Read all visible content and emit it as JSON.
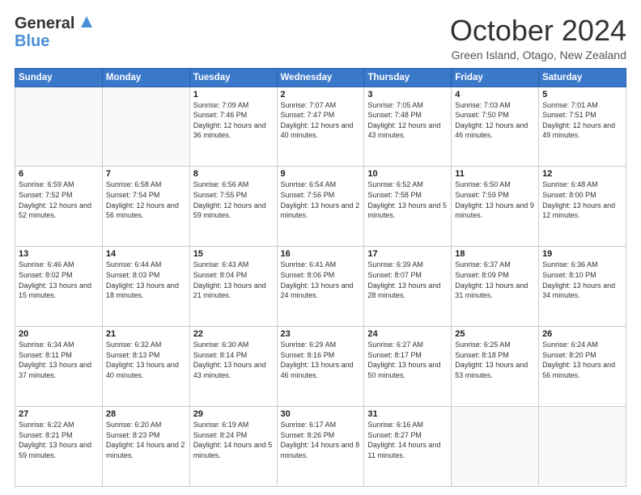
{
  "header": {
    "logo_general": "General",
    "logo_blue": "Blue",
    "month_title": "October 2024",
    "subtitle": "Green Island, Otago, New Zealand"
  },
  "weekdays": [
    "Sunday",
    "Monday",
    "Tuesday",
    "Wednesday",
    "Thursday",
    "Friday",
    "Saturday"
  ],
  "weeks": [
    [
      {
        "day": "",
        "info": ""
      },
      {
        "day": "",
        "info": ""
      },
      {
        "day": "1",
        "info": "Sunrise: 7:09 AM\nSunset: 7:46 PM\nDaylight: 12 hours and 36 minutes."
      },
      {
        "day": "2",
        "info": "Sunrise: 7:07 AM\nSunset: 7:47 PM\nDaylight: 12 hours and 40 minutes."
      },
      {
        "day": "3",
        "info": "Sunrise: 7:05 AM\nSunset: 7:48 PM\nDaylight: 12 hours and 43 minutes."
      },
      {
        "day": "4",
        "info": "Sunrise: 7:03 AM\nSunset: 7:50 PM\nDaylight: 12 hours and 46 minutes."
      },
      {
        "day": "5",
        "info": "Sunrise: 7:01 AM\nSunset: 7:51 PM\nDaylight: 12 hours and 49 minutes."
      }
    ],
    [
      {
        "day": "6",
        "info": "Sunrise: 6:59 AM\nSunset: 7:52 PM\nDaylight: 12 hours and 52 minutes."
      },
      {
        "day": "7",
        "info": "Sunrise: 6:58 AM\nSunset: 7:54 PM\nDaylight: 12 hours and 56 minutes."
      },
      {
        "day": "8",
        "info": "Sunrise: 6:56 AM\nSunset: 7:55 PM\nDaylight: 12 hours and 59 minutes."
      },
      {
        "day": "9",
        "info": "Sunrise: 6:54 AM\nSunset: 7:56 PM\nDaylight: 13 hours and 2 minutes."
      },
      {
        "day": "10",
        "info": "Sunrise: 6:52 AM\nSunset: 7:58 PM\nDaylight: 13 hours and 5 minutes."
      },
      {
        "day": "11",
        "info": "Sunrise: 6:50 AM\nSunset: 7:59 PM\nDaylight: 13 hours and 9 minutes."
      },
      {
        "day": "12",
        "info": "Sunrise: 6:48 AM\nSunset: 8:00 PM\nDaylight: 13 hours and 12 minutes."
      }
    ],
    [
      {
        "day": "13",
        "info": "Sunrise: 6:46 AM\nSunset: 8:02 PM\nDaylight: 13 hours and 15 minutes."
      },
      {
        "day": "14",
        "info": "Sunrise: 6:44 AM\nSunset: 8:03 PM\nDaylight: 13 hours and 18 minutes."
      },
      {
        "day": "15",
        "info": "Sunrise: 6:43 AM\nSunset: 8:04 PM\nDaylight: 13 hours and 21 minutes."
      },
      {
        "day": "16",
        "info": "Sunrise: 6:41 AM\nSunset: 8:06 PM\nDaylight: 13 hours and 24 minutes."
      },
      {
        "day": "17",
        "info": "Sunrise: 6:39 AM\nSunset: 8:07 PM\nDaylight: 13 hours and 28 minutes."
      },
      {
        "day": "18",
        "info": "Sunrise: 6:37 AM\nSunset: 8:09 PM\nDaylight: 13 hours and 31 minutes."
      },
      {
        "day": "19",
        "info": "Sunrise: 6:36 AM\nSunset: 8:10 PM\nDaylight: 13 hours and 34 minutes."
      }
    ],
    [
      {
        "day": "20",
        "info": "Sunrise: 6:34 AM\nSunset: 8:11 PM\nDaylight: 13 hours and 37 minutes."
      },
      {
        "day": "21",
        "info": "Sunrise: 6:32 AM\nSunset: 8:13 PM\nDaylight: 13 hours and 40 minutes."
      },
      {
        "day": "22",
        "info": "Sunrise: 6:30 AM\nSunset: 8:14 PM\nDaylight: 13 hours and 43 minutes."
      },
      {
        "day": "23",
        "info": "Sunrise: 6:29 AM\nSunset: 8:16 PM\nDaylight: 13 hours and 46 minutes."
      },
      {
        "day": "24",
        "info": "Sunrise: 6:27 AM\nSunset: 8:17 PM\nDaylight: 13 hours and 50 minutes."
      },
      {
        "day": "25",
        "info": "Sunrise: 6:25 AM\nSunset: 8:18 PM\nDaylight: 13 hours and 53 minutes."
      },
      {
        "day": "26",
        "info": "Sunrise: 6:24 AM\nSunset: 8:20 PM\nDaylight: 13 hours and 56 minutes."
      }
    ],
    [
      {
        "day": "27",
        "info": "Sunrise: 6:22 AM\nSunset: 8:21 PM\nDaylight: 13 hours and 59 minutes."
      },
      {
        "day": "28",
        "info": "Sunrise: 6:20 AM\nSunset: 8:23 PM\nDaylight: 14 hours and 2 minutes."
      },
      {
        "day": "29",
        "info": "Sunrise: 6:19 AM\nSunset: 8:24 PM\nDaylight: 14 hours and 5 minutes."
      },
      {
        "day": "30",
        "info": "Sunrise: 6:17 AM\nSunset: 8:26 PM\nDaylight: 14 hours and 8 minutes."
      },
      {
        "day": "31",
        "info": "Sunrise: 6:16 AM\nSunset: 8:27 PM\nDaylight: 14 hours and 11 minutes."
      },
      {
        "day": "",
        "info": ""
      },
      {
        "day": "",
        "info": ""
      }
    ]
  ]
}
